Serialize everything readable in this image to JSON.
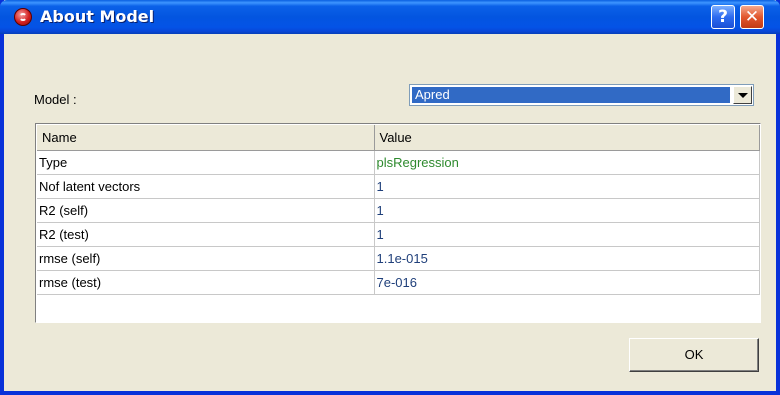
{
  "window": {
    "title": "About Model",
    "help_glyph": "?",
    "close_glyph": "✕",
    "app_icon": "app-logo-icon"
  },
  "model_selector": {
    "label": "Model :",
    "selected": "Apred"
  },
  "table": {
    "headers": [
      "Name",
      "Value"
    ],
    "rows": [
      {
        "name": "Type",
        "value": "plsRegression"
      },
      {
        "name": "Nof latent vectors",
        "value": "1"
      },
      {
        "name": "R2 (self)",
        "value": "1"
      },
      {
        "name": "R2 (test)",
        "value": "1"
      },
      {
        "name": "rmse (self)",
        "value": "1.1e-015"
      },
      {
        "name": "rmse (test)",
        "value": "7e-016"
      }
    ]
  },
  "buttons": {
    "ok_label": "OK"
  },
  "colors": {
    "titlebar": "#0355E0",
    "dialog_bg": "#ECE9D8",
    "selection": "#316AC5",
    "type_value": "#2e8a2e",
    "numeric_value": "#1f3f7a"
  }
}
